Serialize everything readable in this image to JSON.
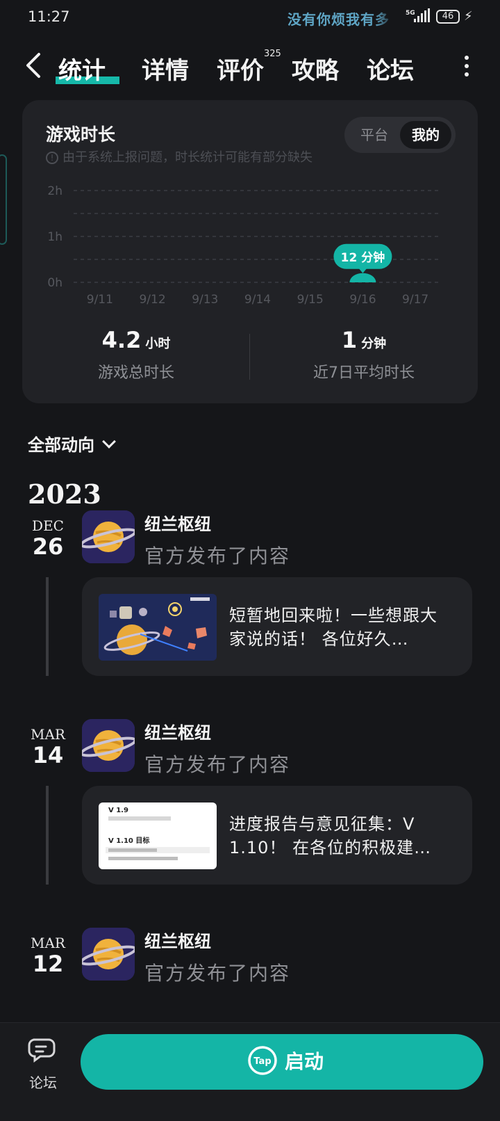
{
  "status_bar": {
    "time": "11:27",
    "banner": "没有你烦我有多",
    "network": "5G",
    "battery": "46"
  },
  "nav": {
    "tabs": [
      {
        "label": "统计"
      },
      {
        "label": "详情"
      },
      {
        "label": "评价"
      },
      {
        "label": "攻略"
      },
      {
        "label": "论坛"
      }
    ],
    "active_tab": "统计",
    "review_count": "325"
  },
  "stats_card": {
    "title": "游戏时长",
    "note": "由于系统上报问题，时长统计可能有部分缺失",
    "toggle": {
      "option1": "平台",
      "option2": "我的",
      "selected": "我的"
    },
    "total": {
      "value": "4.2",
      "unit": "小时",
      "label": "游戏总时长"
    },
    "average": {
      "value": "1",
      "unit": "分钟",
      "label": "近7日平均时长"
    }
  },
  "chart_data": {
    "type": "bar",
    "categories": [
      "9/11",
      "9/12",
      "9/13",
      "9/14",
      "9/15",
      "9/16",
      "9/17"
    ],
    "values": [
      0,
      0,
      0,
      0,
      0,
      12,
      0
    ],
    "unit": "minutes",
    "y_ticks": [
      "0h",
      "1h",
      "2h"
    ],
    "ylim": [
      0,
      120
    ],
    "grid": true,
    "annotation": {
      "category": "9/16",
      "text": "12 分钟"
    }
  },
  "feed": {
    "filter_label": "全部动向",
    "year": "2023",
    "entries": [
      {
        "month": "DEC",
        "day": "26",
        "user": "纽兰枢纽",
        "action": "官方发布了内容",
        "post_text": "短暂地回来啦！一些想跟大家说的话！ 各位好久…"
      },
      {
        "month": "MAR",
        "day": "14",
        "user": "纽兰枢纽",
        "action": "官方发布了内容",
        "post_text": "进度报告与意见征集：V 1.10！ 在各位的积极建…",
        "thumb_text": {
          "v1": "V 1.9",
          "v2": "V 1.10 目标"
        }
      },
      {
        "month": "MAR",
        "day": "12",
        "user": "纽兰枢纽",
        "action": "官方发布了内容"
      }
    ]
  },
  "bottom_bar": {
    "forum_label": "论坛",
    "launch_label": "启动",
    "tap_logo": "Tap"
  },
  "colors": {
    "accent": "#14b5a6",
    "background": "#151619",
    "card": "#212226"
  }
}
